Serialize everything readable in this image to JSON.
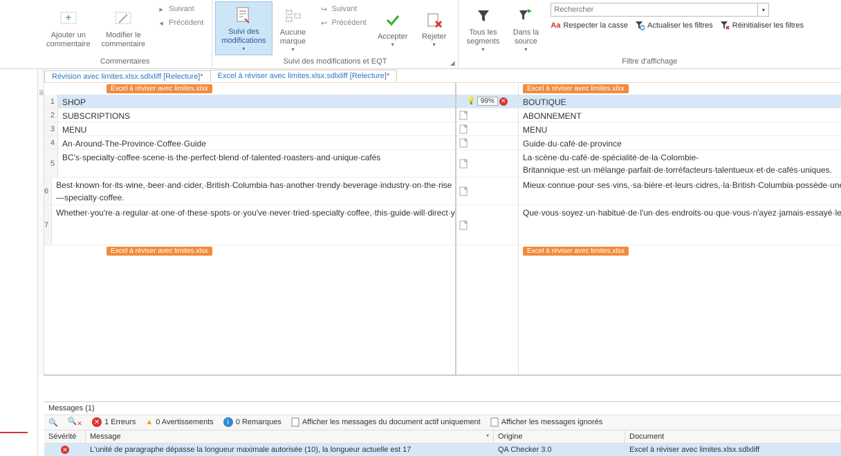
{
  "ribbon": {
    "groups": {
      "comments": {
        "label": "Commentaires",
        "add": "Ajouter un\ncommentaire",
        "edit": "Modifier le\ncommentaire",
        "next": "Suivant",
        "prev": "Précédent"
      },
      "track": {
        "label": "Suivi des modifications et EQT",
        "track_btn": "Suivi des\nmodifications",
        "no_mark": "Aucune\nmarque",
        "next": "Suivant",
        "prev": "Précédent",
        "accept": "Accepter",
        "reject": "Rejeter"
      },
      "filter": {
        "label": "Filtre d'affichage",
        "all_seg": "Tous les\nsegments",
        "in_source": "Dans la\nsource",
        "search_ph": "Rechercher",
        "case": "Respecter la casse",
        "refresh": "Actualiser les filtres",
        "reset": "Réinitialiser les filtres"
      }
    }
  },
  "tabs": [
    "Révision avec limites.xlsx.sdlxliff [Relecture]",
    "Excel à réviser avec limites.xlsx.sdlxliff [Relecture]"
  ],
  "file_tag": "Excel à réviser avec limites.xlsx",
  "rows": [
    {
      "n": "1",
      "src": "SHOP",
      "tgt": "BOUTIQUE",
      "pct": "99%"
    },
    {
      "n": "2",
      "src": "SUBSCRIPTIONS",
      "tgt": "ABONNEMENT"
    },
    {
      "n": "3",
      "src": "MENU",
      "tgt": "MENU"
    },
    {
      "n": "4",
      "src": "An·Around-The-Province·Coffee·Guide",
      "tgt": "Guide·du·café·de·province"
    },
    {
      "n": "5",
      "src": "BC's·specialty·coffee·scene·is·the·perfect·blend·of·talented·roasters·and·unique·cafés",
      "tgt": "La·scène·du·café·de·spécialité·de·la·Colombie-Britannique·est·un·mélange·parfait·de·torréfacteurs·talentueux·et·de·cafés·uniques."
    },
    {
      "n": "6",
      "src": "Best·known·for·its·wine,·beer·and·cider,·British·Columbia·has·another·trendy·beverage·industry·on·the·rise—specialty·coffee.",
      "tgt": "Mieux·connue·pour·ses·vins,·sa·bière·et·leurs·cidres,·la·British·Columbia·possède·une·industrie·de·boissons·à·la·mode·en·plein·essor·:·le·café·de·spécialité."
    },
    {
      "n": "7",
      "src": "Whether·you're·a·regular·at·one·of·these·spots·or·you've·never·tried·specialty·coffee,·this·guide·will·direct·you·to·your·new·favourite·spot·to·refuel·or·just·relax.",
      "tgt": "Que·vous·soyez·un·habitué·de·l'un·des·endroits·ou·que·vous·n'ayez·jamais·essayé·le·café·de·spécialité,·ce·guide·vous·indiquera·votre·nouvel·endroit·préféré·pour·faire·le·plein·ou·détente."
    }
  ],
  "messages": {
    "title": "Messages (1)",
    "errors": "1 Erreurs",
    "warnings": "0 Avertissements",
    "remarks": "0 Remarques",
    "active_only": "Afficher les messages du document actif uniquement",
    "ignored": "Afficher les messages ignorés",
    "cols": {
      "sev": "Sévérité",
      "msg": "Message",
      "org": "Origine",
      "doc": "Document"
    },
    "row": {
      "msg": "L'unité de paragraphe dépasse la longueur maximale autorisée (10), la longueur actuelle est 17",
      "org": "QA Checker 3.0",
      "doc": "Excel à réviser avec limites.xlsx.sdlxliff"
    }
  }
}
